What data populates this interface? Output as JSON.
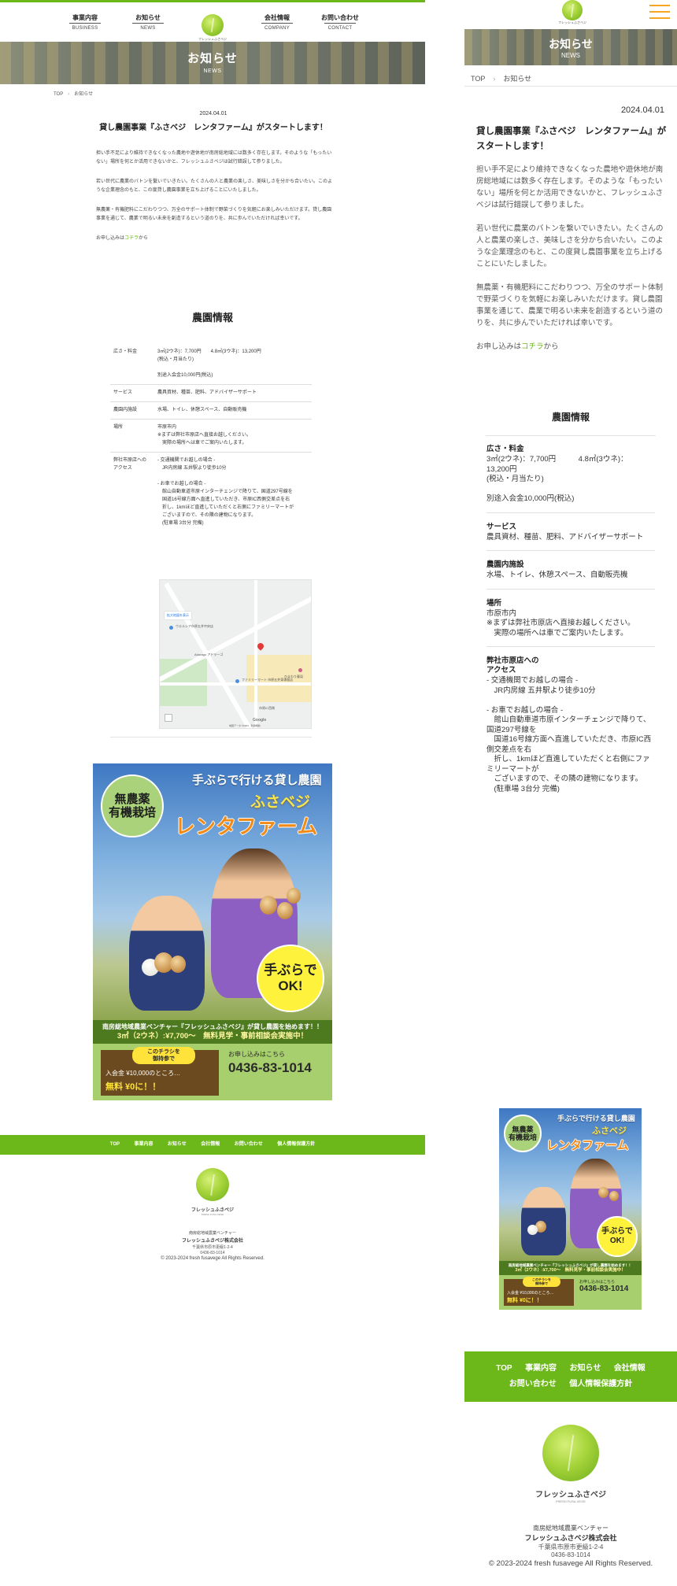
{
  "desktop": {
    "nav": [
      {
        "jp": "事業内容",
        "en": "BUSINESS"
      },
      {
        "jp": "お知らせ",
        "en": "NEWS"
      },
      {
        "jp": "会社情報",
        "en": "COMPANY"
      },
      {
        "jp": "お問い合わせ",
        "en": "CONTACT"
      }
    ],
    "logo_text": "フレッシュふさベジ",
    "hero": {
      "title": "お知らせ",
      "subtitle": "NEWS"
    },
    "breadcrumb": [
      "TOP",
      "お知らせ"
    ]
  },
  "article": {
    "date": "2024.04.01",
    "title": "貸し農園事業『ふさベジ　レンタファーム』がスタートします！",
    "paragraphs": [
      "担い手不足により維持できなくなった農地や遊休地が南房総地域には数多く存在します。そのような「もったいない」場所を何とか活用できないかと、フレッシュふさベジは試行錯誤して参りました。",
      "若い世代に農業のバトンを繋いでいきたい。たくさんの人と農業の楽しさ、美味しさを分かち合いたい。このような企業理念のもと、この度貸し農園事業を立ち上げることにいたしました。",
      "無農薬・有機肥料にこだわりつつ、万全のサポート体制で野菜づくりを気軽にお楽しみいただけます。貸し農園事業を通じて、農業で明るい未来を創造するという道のりを、共に歩んでいただければ幸いです。"
    ],
    "apply_prefix": "お申し込みは",
    "apply_link": "コチラ",
    "apply_suffix": "から"
  },
  "farm": {
    "heading": "農園情報",
    "rows": [
      {
        "label": "広さ・料金",
        "value": "3㎡(2ウネ)：7,700円　　4.8㎡(3ウネ)：13,200円\n(税込・月当たり)\n\n別途入会金10,000円(税込)"
      },
      {
        "label": "サービス",
        "value": "農具資材、種苗、肥料、アドバイザーサポート"
      },
      {
        "label": "農園内施設",
        "value": "水場、トイレ、休憩スペース、自動販売機"
      },
      {
        "label": "場所",
        "value": "市原市内\n※まずは弊社市原店へ直接お越しください。\n　実際の場所へは車でご案内いたします。"
      },
      {
        "label": "弊社市原店への\nアクセス",
        "value": "- 交通機関でお越しの場合 -\n　JR内房線 五井駅より徒歩10分\n\n- お車でお越しの場合 -\n　館山自動車道市原インターチェンジで降りて、国道297号線を\n　国道16号線方面へ直進していただき、市原IC西側交差点を右\n　折し、1kmほど直進していただくと右側にファミリーマートが\n　ございますので、その隣の建物になります。\n　(駐車場 3台分 完備)"
      }
    ]
  },
  "map": {
    "expand_label": "拡大地図を表示",
    "labels": [
      "Adorago アドラーゴ",
      "ファミリーマート 市原五井東嶺島店",
      "ウエルシア市原五井中央店",
      "ひまわり薬局",
      "市原IC西側"
    ],
    "google": "Google",
    "footer": "地図データ ©2024　利用規約"
  },
  "flyer": {
    "headline": "手ぶらで行ける貸し農園",
    "name_small": "ふさベジ",
    "name_big": "レンタファーム",
    "badge_organic": "無農薬\n有機栽培",
    "badge_ok": "手ぶらで\nOK!",
    "strip1": "南房総地域農業ベンチャー『フレッシュふさベジ』が貸し農園を始めます！！",
    "strip2": "3㎡（2ウネ）:¥7,700～　無料見学・事前相談会実施中！",
    "coupon_tag": "このチラシを\n御持参で",
    "coupon_line1": "入会金 ¥10,000のところ…",
    "coupon_line2": "無料 ¥0に！！",
    "contact_label": "お申し込みはこちら",
    "tel": "0436-83-1014"
  },
  "footer": {
    "nav": [
      "TOP",
      "事業内容",
      "お知らせ",
      "会社情報",
      "お問い合わせ",
      "個人情報保護方針"
    ],
    "logo_text": "フレッシュふさベジ",
    "logo_en": "FRESH FUSA-VEGE",
    "tagline": "南房総地域農業ベンチャー",
    "company": "フレッシュふさベジ株式会社",
    "address": "千葉県市原市更級1-2-4",
    "tel": "0436-83-1014",
    "copyright": "© 2023-2024 fresh fusavege All Rights Reserved."
  },
  "mobile": {
    "hero": {
      "title": "お知らせ",
      "subtitle": "NEWS"
    },
    "breadcrumb": [
      "TOP",
      "お知らせ"
    ],
    "farm_rows": [
      {
        "label": "広さ・料金",
        "value": "3㎡(2ウネ)：7,700円　　　4.8㎡(3ウネ)：\n13,200円\n(税込・月当たり)\n\n別途入会金10,000円(税込)"
      },
      {
        "label": "サービス",
        "value": "農具資材、種苗、肥料、アドバイザーサポート"
      },
      {
        "label": "農園内施設",
        "value": "水場、トイレ、休憩スペース、自動販売機"
      },
      {
        "label": "場所",
        "value": "市原市内\n※まずは弊社市原店へ直接お越しください。\n　実際の場所へは車でご案内いたします。"
      },
      {
        "label": "弊社市原店への\nアクセス",
        "value": "- 交通機関でお越しの場合 -\n　JR内房線 五井駅より徒歩10分\n\n- お車でお越しの場合 -\n　館山自動車道市原インターチェンジで降りて、国道297号線を\n　国道16号線方面へ直進していただき、市原IC西側交差点を右\n　折し、1kmほど直進していただくと右側にファミリーマートが\n　ございますので、その隣の建物になります。\n　(駐車場 3台分 完備)"
      }
    ],
    "footer_nav_row1": [
      "TOP",
      "事業内容",
      "お知らせ",
      "会社情報"
    ],
    "footer_nav_row2": [
      "お問い合わせ",
      "個人情報保護方針"
    ]
  },
  "colors": {
    "accent": "#6cb81a",
    "hamburger": "#f6a623"
  }
}
